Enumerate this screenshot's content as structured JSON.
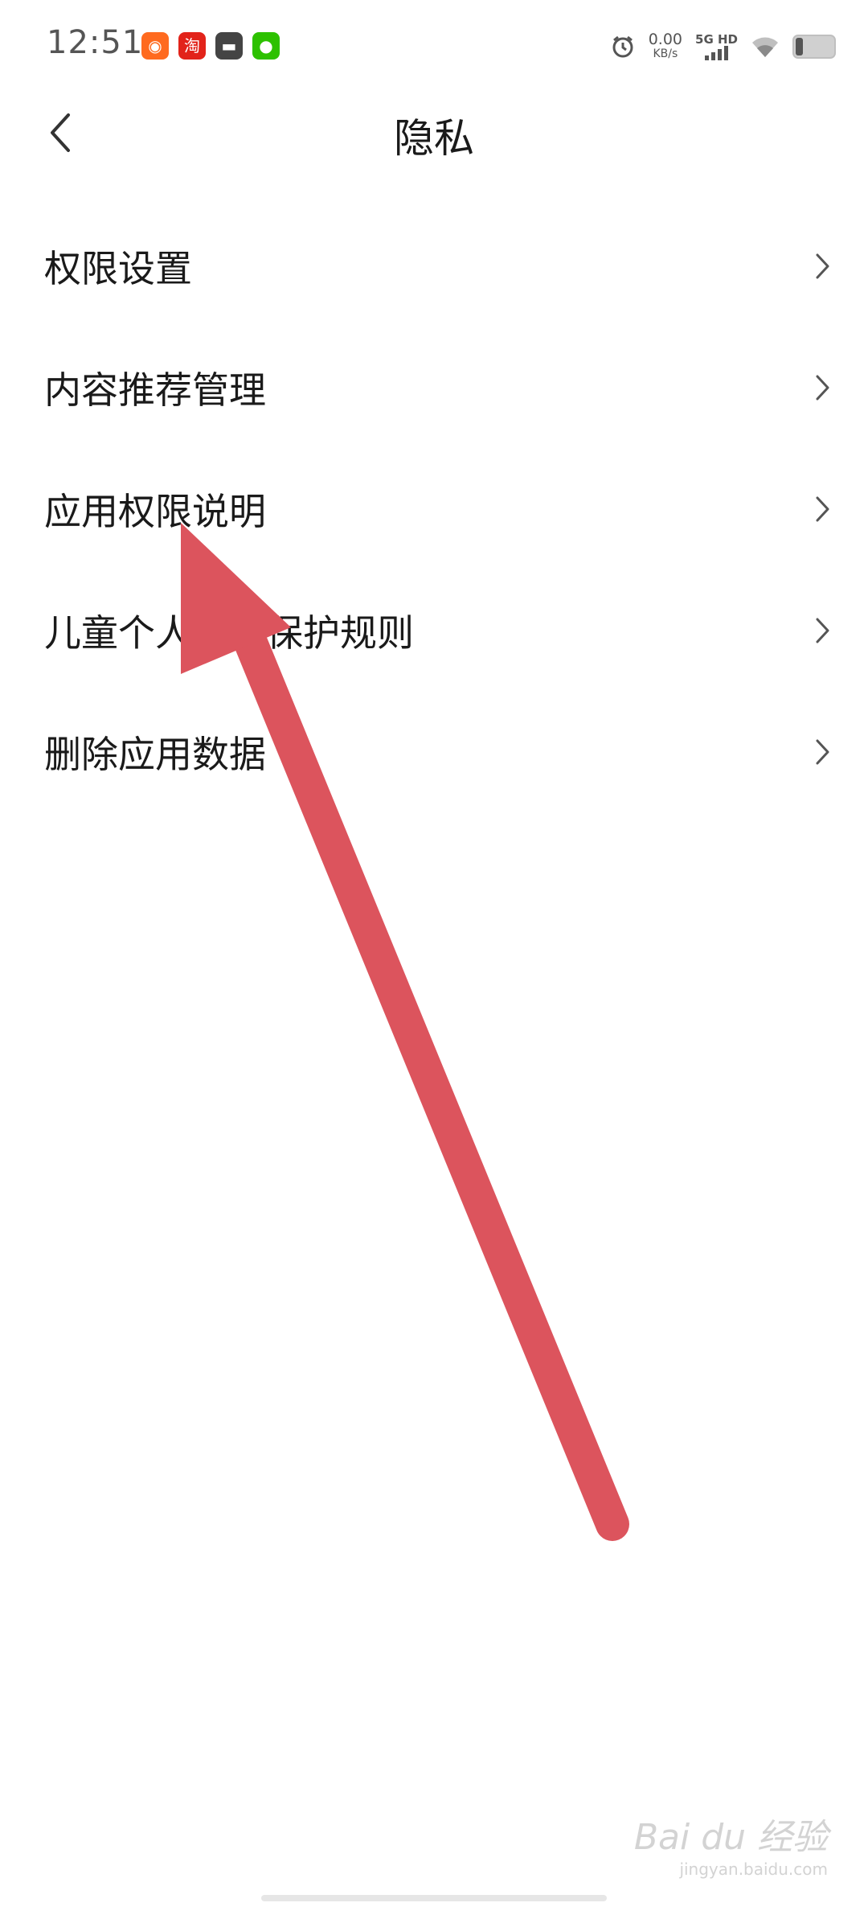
{
  "status_bar": {
    "time": "12:51",
    "net_speed_value": "0.00",
    "net_speed_unit": "KB/s",
    "network_label": "5G HD",
    "battery_level": 0.2,
    "app_icons": [
      "kuaishou-icon",
      "taobao-icon",
      "app-icon",
      "wechat-icon"
    ]
  },
  "header": {
    "title": "隐私"
  },
  "menu": {
    "items": [
      {
        "label": "权限设置"
      },
      {
        "label": "内容推荐管理"
      },
      {
        "label": "应用权限说明"
      },
      {
        "label": "儿童个人信息保护规则"
      },
      {
        "label": "删除应用数据"
      }
    ]
  },
  "watermark": {
    "brand": "Bai du 经验",
    "site": "jingyan.baidu.com"
  },
  "colors": {
    "accent_arrow": "#dc545d",
    "text_primary": "#1a1a1a",
    "chevron": "#555555"
  }
}
